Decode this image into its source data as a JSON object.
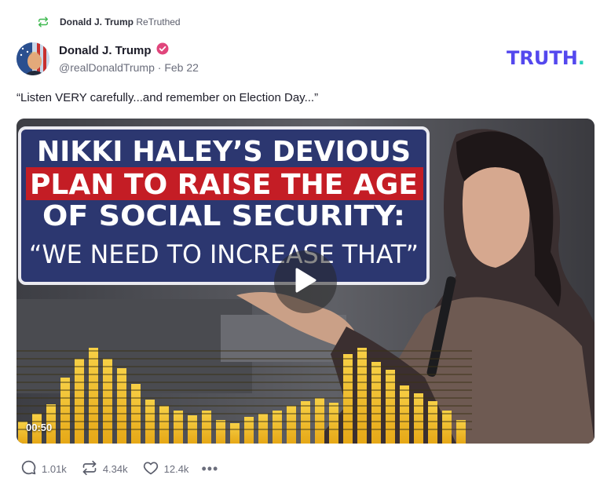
{
  "retruth": {
    "author": "Donald J. Trump",
    "label": "ReTruthed",
    "icon": "retruth-icon"
  },
  "post": {
    "author_name": "Donald J. Trump",
    "handle": "@realDonaldTrump",
    "date_sep": "·",
    "date": "Feb 22",
    "verified_icon": "verified-badge-icon",
    "text": "“Listen VERY carefully...and remember on Election Day...”"
  },
  "brand": {
    "logo_text": "TRUTH",
    "logo_dot": ".",
    "color": "#5448ee",
    "dot_color": "#27d1ba"
  },
  "video": {
    "headline_line1": "NIKKI HALEY’S DEVIOUS",
    "headline_line2": "PLAN TO RAISE THE AGE",
    "headline_line3": "OF SOCIAL SECURITY:",
    "quote": "“WE NEED TO INCREASE THAT”",
    "duration": "00:50",
    "play_icon": "play-icon"
  },
  "actions": {
    "replies": "1.01k",
    "retruths": "4.34k",
    "likes": "12.4k",
    "more": "•••"
  }
}
